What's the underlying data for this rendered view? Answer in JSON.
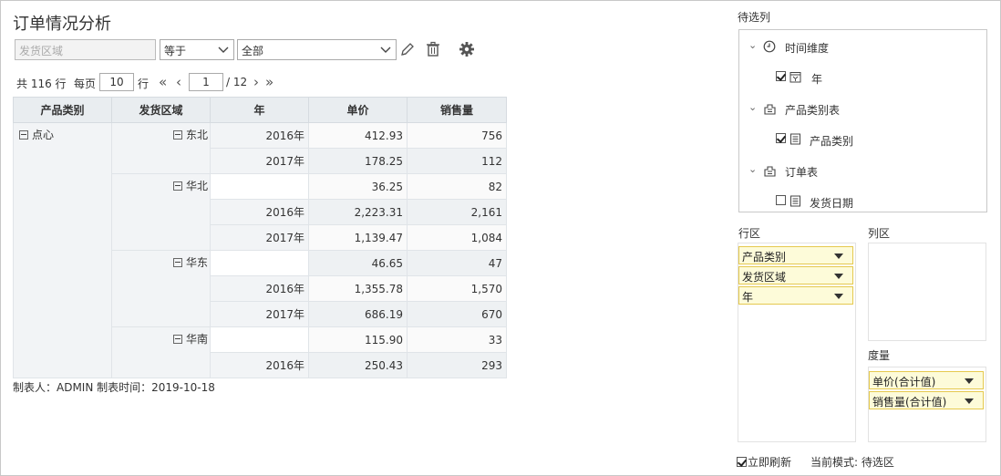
{
  "title": "订单情况分析",
  "filter": {
    "field_placeholder": "发货区域",
    "operator": "等于",
    "value": "全部"
  },
  "pager": {
    "total_text": "共 116 行",
    "per_page_label": "每页",
    "per_page_value": "10",
    "rows_unit": "行",
    "first": "«",
    "prev": "‹",
    "current_page": "1",
    "total_pages": "/ 12",
    "next": "›",
    "last": "»"
  },
  "table": {
    "headers": [
      "产品类别",
      "发货区域",
      "年",
      "单价",
      "销售量"
    ],
    "category": "点心",
    "regions": [
      "东北",
      "华北",
      "华东",
      "华南"
    ],
    "rows": [
      {
        "year": "2016年",
        "price": "412.93",
        "qty": "756"
      },
      {
        "year": "2017年",
        "price": "178.25",
        "qty": "112"
      },
      {
        "year": "",
        "price": "36.25",
        "qty": "82"
      },
      {
        "year": "2016年",
        "price": "2,223.31",
        "qty": "2,161"
      },
      {
        "year": "2017年",
        "price": "1,139.47",
        "qty": "1,084"
      },
      {
        "year": "",
        "price": "46.65",
        "qty": "47"
      },
      {
        "year": "2016年",
        "price": "1,355.78",
        "qty": "1,570"
      },
      {
        "year": "2017年",
        "price": "686.19",
        "qty": "670"
      },
      {
        "year": "",
        "price": "115.90",
        "qty": "33"
      },
      {
        "year": "2016年",
        "price": "250.43",
        "qty": "293"
      }
    ]
  },
  "meta": "制表人：ADMIN  制表时间：2019-10-18",
  "side": {
    "candidates_label": "待选列",
    "tree": {
      "time_dim": "时间维度",
      "year": "年",
      "product_table": "产品类别表",
      "product_category": "产品类别",
      "order_table": "订单表",
      "ship_date": "发货日期"
    },
    "rows_label": "行区",
    "cols_label": "列区",
    "measures_label": "度量",
    "row_chips": [
      "产品类别",
      "发货区域",
      "年"
    ],
    "measure_chips": [
      "单价(合计值)",
      "销售量(合计值)"
    ],
    "auto_refresh": "立即刷新",
    "mode_text": "当前模式: 待选区"
  }
}
